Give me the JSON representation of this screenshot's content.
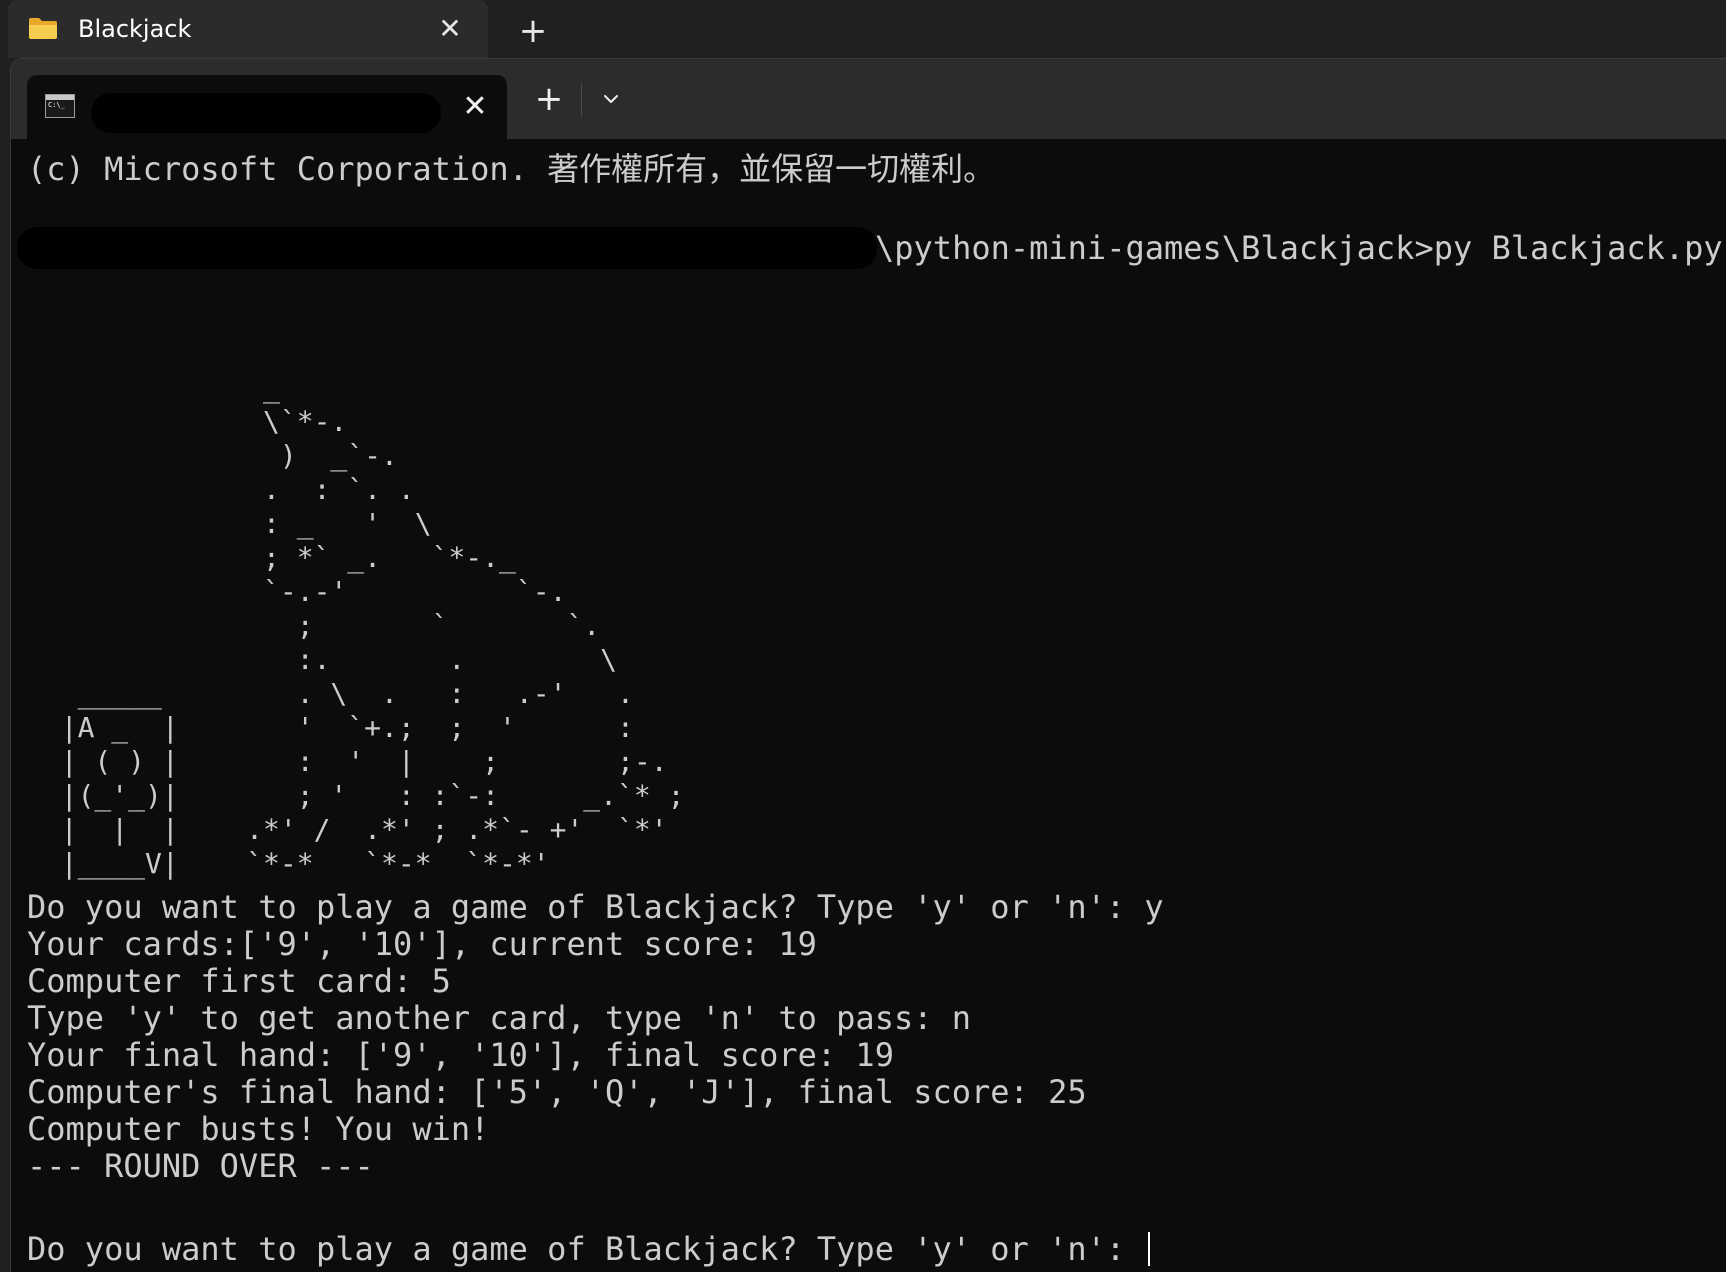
{
  "window": {
    "outer_tab_title": "Blackjack",
    "outer_close_glyph": "✕",
    "outer_new_tab_glyph": "+"
  },
  "terminal": {
    "tab_icon_text": "C:\\_",
    "tab_close_glyph": "✕",
    "new_tab_glyph": "+"
  },
  "console": {
    "copyright": "(c) Microsoft Corporation. 著作權所有，並保留一切權利。",
    "prompt_command": "\\python-mini-games\\Blackjack>py Blackjack.py",
    "ascii_art": "              _\n              \\`*-.\n               )  _`-.\n              .  : `. .\n              : _   '  \\\n              ; *` _.   `*-._\n              `-.-'          `-.\n                ;       `       `.\n                :.       .        \\\n   _____        . \\  .   :   .-'   .\n  |A _  |       '  `+.;  ;  '      :\n  | ( ) |       :  '  |    ;       ;-.\n  |(_'_)|       ; '   : :`-:     _.`* ;\n  |  |  |    .*' /  .*' ; .*`- +'  `*'\n  |____V|    `*-*   `*-*  `*-*'",
    "output_lines": [
      "Do you want to play a game of Blackjack? Type 'y' or 'n': y",
      "Your cards:['9', '10'], current score: 19",
      "Computer first card: 5",
      "Type 'y' to get another card, type 'n' to pass: n",
      "Your final hand: ['9', '10'], final score: 19",
      "Computer's final hand: ['5', 'Q', 'J'], final score: 25",
      "Computer busts! You win!",
      "--- ROUND OVER ---",
      ""
    ],
    "final_prompt": "Do you want to play a game of Blackjack? Type 'y' or 'n': "
  },
  "colors": {
    "console_background": "#0c0c0c",
    "console_text": "#cccccc",
    "tab_bar": "#2c2c2c",
    "outer_bar": "#202020",
    "folder_icon": "#f4c542"
  },
  "icons": {
    "outer_tab": "folder-icon",
    "terminal_tab": "command-prompt-icon",
    "close": "close-icon",
    "new_tab": "plus-icon",
    "dropdown": "chevron-down-icon"
  }
}
